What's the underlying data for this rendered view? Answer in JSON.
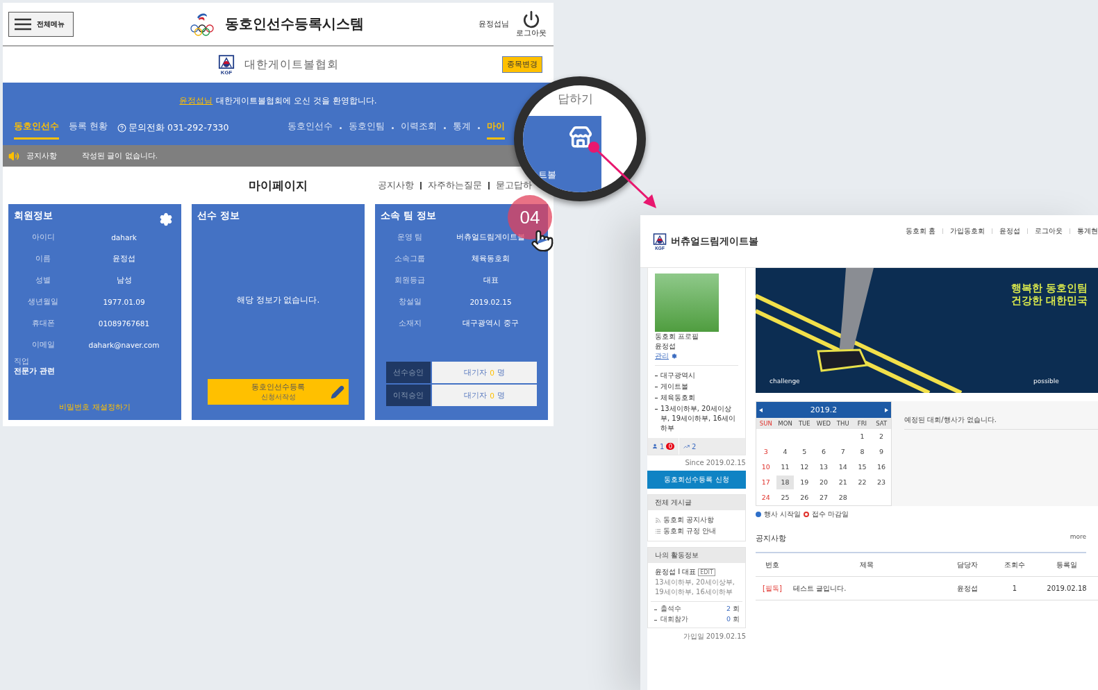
{
  "left_screen": {
    "header": {
      "menu_button": "전체메뉴",
      "title": "동호인선수등록시스템",
      "user": "윤정섭님",
      "logout": "로그아웃"
    },
    "association": {
      "logo_text": "KGF",
      "name": "대한게이트볼협회",
      "change_button": "종목변경"
    },
    "welcome": {
      "user_link": "윤정섭님",
      "message": "대한게이트볼협회에 오신 것을 환영합니다."
    },
    "subnav": [
      {
        "label": "동호인선수",
        "selected": true
      },
      {
        "label": "등록 현황",
        "selected": false
      }
    ],
    "phone": "문의전화 031-292-7330",
    "main_nav": [
      {
        "label": "동호인선수",
        "selected": false
      },
      {
        "label": "동호인팀",
        "selected": false
      },
      {
        "label": "이력조회",
        "selected": false
      },
      {
        "label": "통계",
        "selected": false
      },
      {
        "label": "마이",
        "selected": true
      }
    ],
    "notice_bar": {
      "label": "공지사항",
      "message": "작성된 글이 없습니다."
    },
    "page_title": "마이페이지",
    "page_links": [
      "공지사항",
      "자주하는질문",
      "묻고답하"
    ],
    "member_card": {
      "title": "회원정보",
      "rows": [
        {
          "label": "아이디",
          "value": "dahark"
        },
        {
          "label": "이름",
          "value": "윤정섭"
        },
        {
          "label": "성별",
          "value": "남성"
        },
        {
          "label": "생년월일",
          "value": "1977.01.09"
        },
        {
          "label": "휴대폰",
          "value": "01089767681"
        },
        {
          "label": "이메일",
          "value": "dahark@naver.com"
        }
      ],
      "job_label": "직업",
      "job_value": "전문가 관련",
      "reset_link": "비밀번호 재설정하기"
    },
    "player_card": {
      "title": "선수 정보",
      "empty": "해당 정보가 없습니다.",
      "register_button": {
        "label": "동호인선수등록",
        "sub": "신청서작성"
      }
    },
    "team_card": {
      "title": "소속 팀 정보",
      "rows": [
        {
          "label": "운영 팀",
          "value": "버츄얼드림게이트볼"
        },
        {
          "label": "소속그룹",
          "value": "체육동호회"
        },
        {
          "label": "회원등급",
          "value": "대표"
        },
        {
          "label": "창설일",
          "value": "2019.02.15"
        },
        {
          "label": "소재지",
          "value": "대구광역시 중구"
        }
      ],
      "approvals": [
        {
          "label": "선수승인",
          "prefix": "대기자",
          "count": "0",
          "unit": "명"
        },
        {
          "label": "이적승인",
          "prefix": "대기자",
          "count": "0",
          "unit": "명"
        }
      ]
    }
  },
  "tutorial": {
    "step_badge": "04",
    "magnifier": {
      "top_text": "답하기",
      "tile_text": "트볼"
    }
  },
  "right_screen": {
    "header": {
      "logo_text": "KGF",
      "club_name": "버츄얼드림게이트볼",
      "nav": [
        "동호회 홈",
        "가입동호회",
        "윤정섭",
        "로그아웃",
        "통계현"
      ]
    },
    "sidebar": {
      "profile_link": "동호회 프로필",
      "owner": "윤정섭",
      "manage_link": "관리",
      "tags": [
        "대구광역시",
        "게이트볼",
        "체육동호회",
        "13세이하부, 20세이상부, 19세이하부, 16세이하부"
      ],
      "members": "1",
      "new_badge": "0",
      "visits": "2",
      "since": "Since 2019.02.15",
      "register_button": "동호회선수등록 신청",
      "boards": {
        "title": "전체 게시글",
        "items": [
          {
            "kind": "notice",
            "label": "동호회 공지사항"
          },
          {
            "kind": "rules",
            "label": "동호회 규정 안내"
          }
        ]
      },
      "activity": {
        "title": "나의 활동정보",
        "name": "윤정섭 I 대표",
        "edit_tag": "EDIT",
        "divisions": "13세이하부, 20세이상부, 19세이하부, 16세이하부",
        "stats": [
          {
            "label": "출석수",
            "count": "2",
            "unit": "회"
          },
          {
            "label": "대회참가",
            "count": "0",
            "unit": "회"
          }
        ]
      },
      "joined": "가입일 2019.02.15"
    },
    "banner": {
      "headline": [
        "행복한 동호인팀",
        "건강한 대한민국"
      ],
      "left_caption": "challenge",
      "right_caption": "possible"
    },
    "calendar": {
      "title": "2019.2",
      "weekdays": [
        "SUN",
        "MON",
        "TUE",
        "WED",
        "THU",
        "FRI",
        "SAT"
      ],
      "weeks": [
        {
          "days": [
            {
              "kind": "blank"
            },
            {
              "kind": "blank"
            },
            {
              "kind": "blank"
            },
            {
              "kind": "blank"
            },
            {
              "kind": "blank"
            },
            {
              "kind": "date",
              "day": "1",
              "selected": false
            },
            {
              "kind": "date",
              "day": "2",
              "selected": false
            }
          ]
        },
        {
          "days": [
            {
              "kind": "date",
              "day": "3",
              "selected": false
            },
            {
              "kind": "date",
              "day": "4",
              "selected": false
            },
            {
              "kind": "date",
              "day": "5",
              "selected": false
            },
            {
              "kind": "date",
              "day": "6",
              "selected": false
            },
            {
              "kind": "date",
              "day": "7",
              "selected": false
            },
            {
              "kind": "date",
              "day": "8",
              "selected": false
            },
            {
              "kind": "date",
              "day": "9",
              "selected": false
            }
          ]
        },
        {
          "days": [
            {
              "kind": "date",
              "day": "10",
              "selected": false
            },
            {
              "kind": "date",
              "day": "11",
              "selected": false
            },
            {
              "kind": "date",
              "day": "12",
              "selected": false
            },
            {
              "kind": "date",
              "day": "13",
              "selected": false
            },
            {
              "kind": "date",
              "day": "14",
              "selected": false
            },
            {
              "kind": "date",
              "day": "15",
              "selected": false
            },
            {
              "kind": "date",
              "day": "16",
              "selected": false
            }
          ]
        },
        {
          "days": [
            {
              "kind": "date",
              "day": "17",
              "selected": false
            },
            {
              "kind": "date",
              "day": "18",
              "selected": true
            },
            {
              "kind": "date",
              "day": "19",
              "selected": false
            },
            {
              "kind": "date",
              "day": "20",
              "selected": false
            },
            {
              "kind": "date",
              "day": "21",
              "selected": false
            },
            {
              "kind": "date",
              "day": "22",
              "selected": false
            },
            {
              "kind": "date",
              "day": "23",
              "selected": false
            }
          ]
        },
        {
          "days": [
            {
              "kind": "date",
              "day": "24",
              "selected": false
            },
            {
              "kind": "date",
              "day": "25",
              "selected": false
            },
            {
              "kind": "date",
              "day": "26",
              "selected": false
            },
            {
              "kind": "date",
              "day": "27",
              "selected": false
            },
            {
              "kind": "date",
              "day": "28",
              "selected": false
            }
          ]
        }
      ]
    },
    "schedule_empty": "예정된 대회/행사가 없습니다.",
    "legend": [
      {
        "kind": "dot",
        "label": "행사 시작일",
        "color": "#2e6fc9"
      },
      {
        "kind": "ring",
        "label": "접수 마감일",
        "color": "#e0322c"
      }
    ],
    "notices": {
      "title": "공지사항",
      "more": "more",
      "columns": [
        "번호",
        "제목",
        "담당자",
        "조회수",
        "등록일"
      ],
      "rows": [
        {
          "tag": "[필독]",
          "title": "테스트 글입니다.",
          "author": "윤정섭",
          "views": "1",
          "date": "2019.02.18"
        }
      ]
    }
  }
}
